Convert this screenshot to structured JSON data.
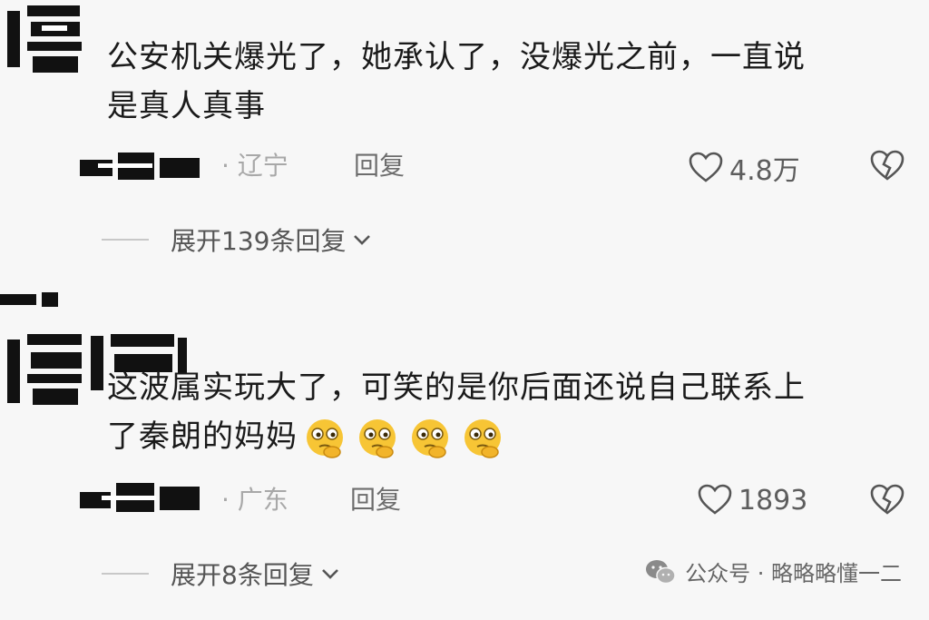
{
  "comments": [
    {
      "text_line1": "公安机关爆光了，她承认了，没爆光之前，一直说",
      "text_line2": "是真人真事",
      "location": "· 辽宁",
      "reply_label": "回复",
      "likes": "4.8万",
      "expand_label": "展开139条回复"
    },
    {
      "text_line1": "这波属实玩大了，可笑的是你后面还说自己联系上",
      "text_line2": "了秦朗的妈妈",
      "emoji_count": 4,
      "location": "· 广东",
      "reply_label": "回复",
      "likes": "1893",
      "expand_label": "展开8条回复"
    }
  ],
  "watermark": {
    "text": "公众号 · 略略略懂一二",
    "icon": "wechat-icon"
  },
  "colors": {
    "background": "#f7f7f7",
    "text": "#1a1a1a",
    "muted": "#a8a8a8",
    "emoji": "#f7c535"
  }
}
